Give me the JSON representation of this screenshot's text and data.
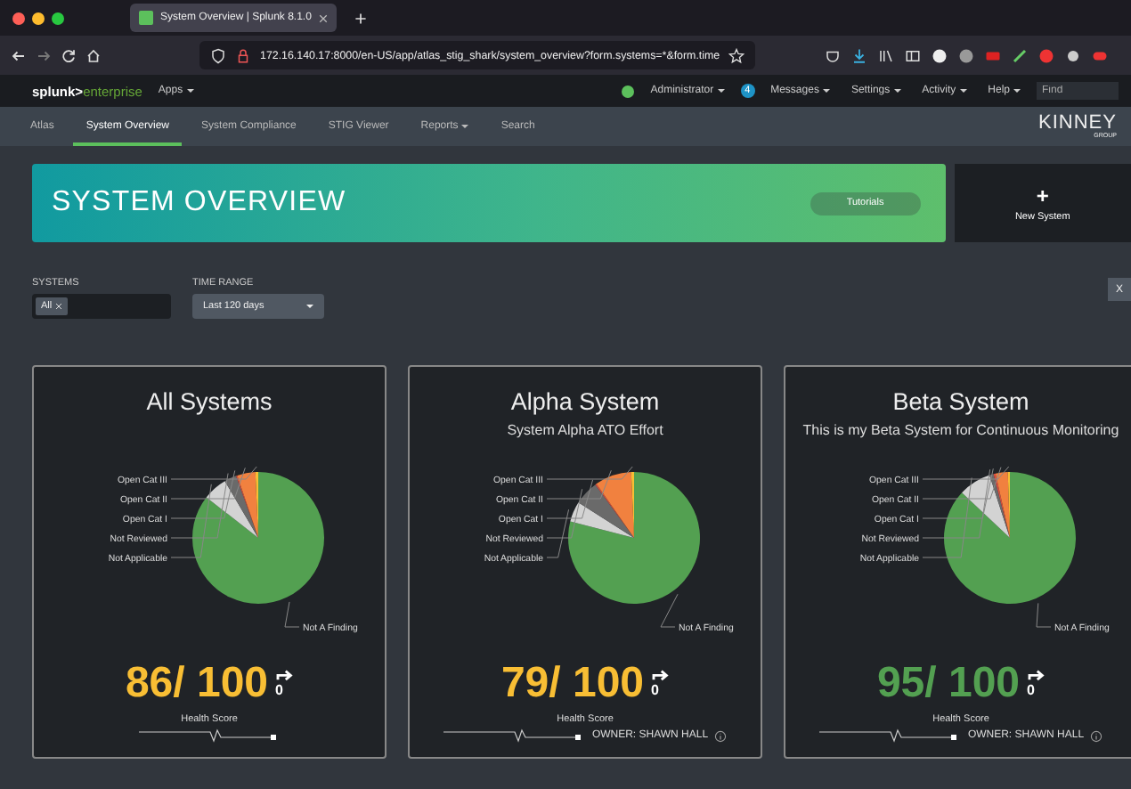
{
  "browser": {
    "tab_title": "System Overview | Splunk 8.1.0",
    "url": "172.16.140.17:8000/en-US/app/atlas_stig_shark/system_overview?form.systems=*&form.time"
  },
  "splunk_bar": {
    "logo_left": "splunk>",
    "logo_right": "enterprise",
    "apps": "Apps",
    "user": "Administrator",
    "messages_count": "4",
    "messages": "Messages",
    "menus": [
      "Settings",
      "Activity",
      "Help"
    ],
    "find_placeholder": "Find"
  },
  "app_nav": {
    "items": [
      {
        "label": "Atlas",
        "selected": false,
        "dropdown": false
      },
      {
        "label": "System Overview",
        "selected": true,
        "dropdown": false
      },
      {
        "label": "System Compliance",
        "selected": false,
        "dropdown": false
      },
      {
        "label": "STIG Viewer",
        "selected": false,
        "dropdown": false
      },
      {
        "label": "Reports",
        "selected": false,
        "dropdown": true
      },
      {
        "label": "Search",
        "selected": false,
        "dropdown": false
      }
    ],
    "logo": "KINNEY",
    "logo_sub": "GROUP"
  },
  "banner": {
    "title": "SYSTEM OVERVIEW",
    "button": "Tutorials"
  },
  "new_system": {
    "icon": "+",
    "label": "New System"
  },
  "filters": {
    "systems_label": "SYSTEMS",
    "systems_token": "All",
    "time_label": "TIME RANGE",
    "time_value": "Last 120 days",
    "close": "X"
  },
  "systems": [
    {
      "name": "All Systems",
      "color": "#f8be34",
      "score": "86/ 100",
      "trend": "0",
      "health_label": "Health Score",
      "chart_data": {
        "type": "pie",
        "categories": [
          "Not A Finding",
          "Not Applicable",
          "Not Reviewed",
          "Open Cat I",
          "Open Cat II",
          "Open Cat III"
        ],
        "values": [
          86,
          6,
          3,
          0.3,
          4.5,
          0.7
        ]
      }
    },
    {
      "name": "Alpha System",
      "description": "System Alpha ATO Effort",
      "owner": "OWNER: SHAWN HALL",
      "color": "#f8be34",
      "score": "79/ 100",
      "trend": "0",
      "health_label": "Health Score",
      "chart_data": {
        "type": "pie",
        "categories": [
          "Not A Finding",
          "Not Applicable",
          "Not Reviewed",
          "Open Cat I",
          "Open Cat II",
          "Open Cat III"
        ],
        "values": [
          79,
          5,
          6,
          0.3,
          9,
          0.7
        ]
      }
    },
    {
      "name": "Beta System",
      "description": "This is my Beta System for Continuous Monitoring",
      "owner": "OWNER: SHAWN HALL",
      "color": "#53a051",
      "score": "95/ 100",
      "trend": "0",
      "health_label": "Health Score",
      "chart_data": {
        "type": "pie",
        "categories": [
          "Not A Finding",
          "Not Applicable",
          "Not Reviewed",
          "Open Cat I",
          "Open Cat II",
          "Open Cat III"
        ],
        "values": [
          87,
          8,
          1,
          0.5,
          3,
          0.5
        ]
      }
    }
  ]
}
